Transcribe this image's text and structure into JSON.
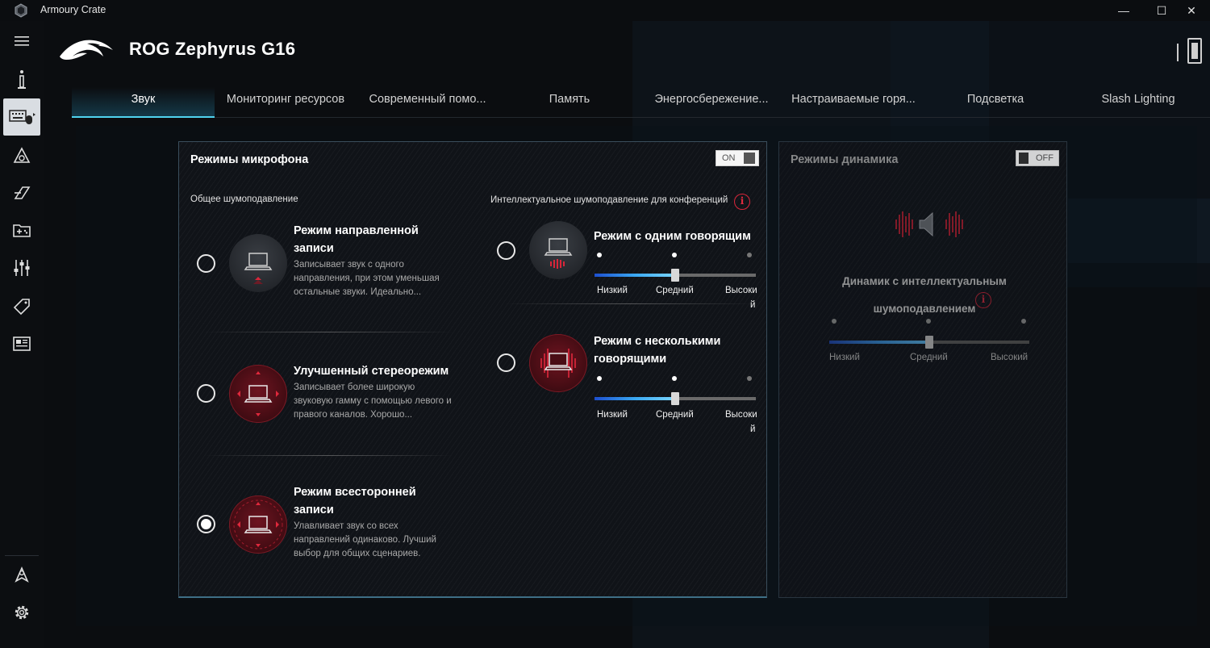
{
  "window": {
    "title": "Armoury Crate",
    "minimize": "—",
    "maximize": "☐",
    "close": "✕"
  },
  "header": {
    "device_title": "ROG Zephyrus G16"
  },
  "tabs": [
    {
      "label": "Звук",
      "active": true
    },
    {
      "label": "Мониторинг ресурсов"
    },
    {
      "label": "Современный помо..."
    },
    {
      "label": "Память"
    },
    {
      "label": "Энергосбережение..."
    },
    {
      "label": "Настраиваемые горя..."
    },
    {
      "label": "Подсветка"
    },
    {
      "label": "Slash Lighting"
    }
  ],
  "mic_panel": {
    "title": "Режимы микрофона",
    "toggle_label": "ON",
    "general_label": "Общее шумоподавление",
    "ai_label": "Интеллектуальное шумоподавление для конференций",
    "info_glyph": "i",
    "modes": [
      {
        "title": "Режим направленной записи",
        "desc": "Записывает звук с одного направления, при этом уменьшая остальные звуки. Идеально...",
        "selected": false
      },
      {
        "title": "Улучшенный стереорежим",
        "desc": "Записывает более широкую звуковую гамму с помощью левого и правого каналов. Хорошо...",
        "selected": false
      },
      {
        "title": "Режим всесторонней записи",
        "desc": "Улавливает звук со всех направлений одинаково. Лучший выбор для общих сценариев.",
        "selected": true
      }
    ],
    "ai_modes": [
      {
        "title": "Режим с одним говорящим",
        "low": "Низкий",
        "mid": "Средний",
        "high": "Высоки",
        "high_wrap": "й",
        "level": 0.5,
        "selected": false
      },
      {
        "title": "Режим с несколькими говорящими",
        "low": "Низкий",
        "mid": "Средний",
        "high": "Высоки",
        "high_wrap": "й",
        "level": 0.5,
        "selected": false
      }
    ]
  },
  "speaker_panel": {
    "title": "Режимы динамика",
    "toggle_label": "OFF",
    "feature_title_line1": "Динамик с интеллектуальным",
    "feature_title_line2": "шумоподавлением",
    "info_glyph": "i",
    "low": "Низкий",
    "mid": "Средний",
    "high": "Высокий",
    "level": 0.5
  },
  "colors": {
    "accent_cyan": "#4fd3ef",
    "rog_red": "#d8263a",
    "slider_blue": "#3aa8f2"
  }
}
